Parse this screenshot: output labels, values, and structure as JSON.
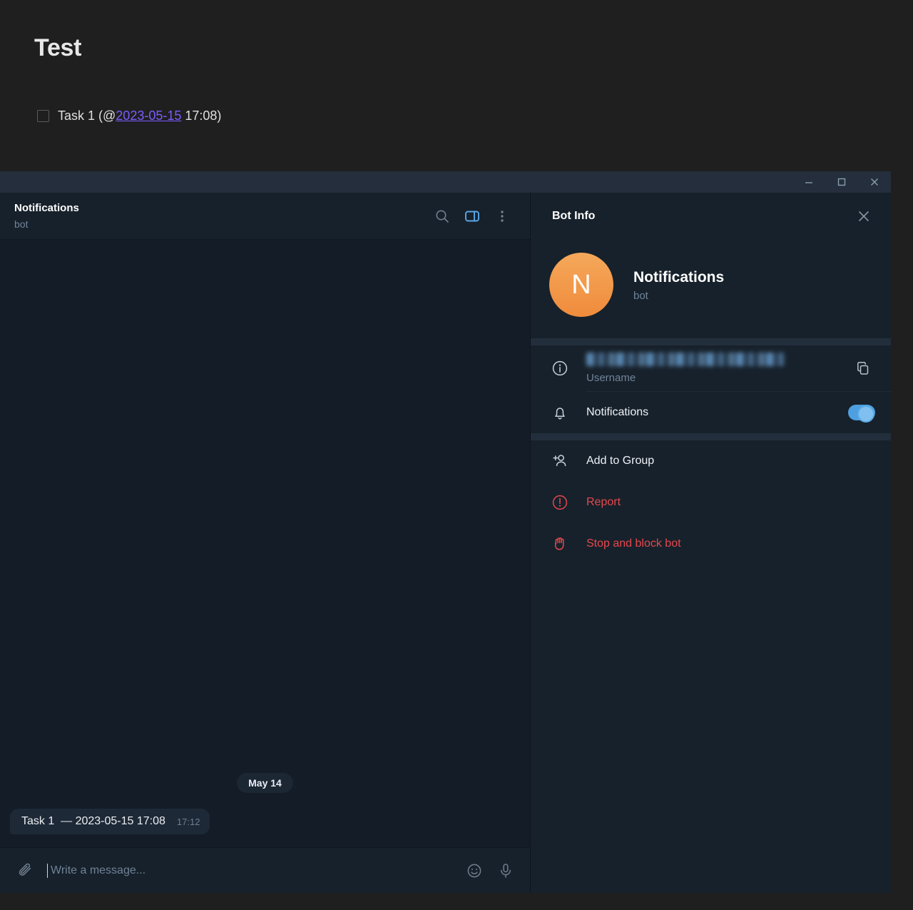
{
  "document": {
    "title": "Test",
    "task": {
      "checkbox_state": "unchecked",
      "prefix": "Task 1 (@",
      "link": "2023-05-15",
      "suffix": " 17:08)"
    }
  },
  "window": {
    "controls": {
      "minimize": "minimize-icon",
      "maximize": "maximize-icon",
      "close": "close-icon"
    }
  },
  "chat": {
    "header": {
      "title": "Notifications",
      "subtitle": "bot",
      "icons": {
        "search": "search-icon",
        "panel_toggle": "panel-toggle-icon",
        "more": "more-vertical-icon"
      }
    },
    "date_separator": "May 14",
    "messages": [
      {
        "text": "Task 1  — 2023-05-15 17:08",
        "time": "17:12"
      }
    ],
    "composer": {
      "attach_icon": "paperclip-icon",
      "placeholder": "Write a message...",
      "value": "",
      "emoji_icon": "smiley-icon",
      "voice_icon": "microphone-icon"
    }
  },
  "info_panel": {
    "title": "Bot Info",
    "close_icon": "close-icon",
    "profile": {
      "avatar_letter": "N",
      "name": "Notifications",
      "subtitle": "bot"
    },
    "rows": [
      {
        "icon": "info-circle-icon",
        "value": "",
        "value_hidden": true,
        "label": "Username",
        "action_icon": "copy-icon"
      },
      {
        "icon": "bell-icon",
        "title": "Notifications",
        "toggle": "on"
      }
    ],
    "actions": [
      {
        "icon": "add-user-icon",
        "label": "Add to Group",
        "danger": false
      },
      {
        "icon": "report-icon",
        "label": "Report",
        "danger": true
      },
      {
        "icon": "block-hand-icon",
        "label": "Stop and block bot",
        "danger": true
      }
    ]
  },
  "colors": {
    "page_background": "#1f1f1f",
    "window_background": "#17212b",
    "chat_background": "#141c27",
    "accent_blue": "#4d9fe0",
    "danger_red": "#e5484d",
    "link_purple": "#7c5cff",
    "avatar_orange": "#f08b3c"
  }
}
